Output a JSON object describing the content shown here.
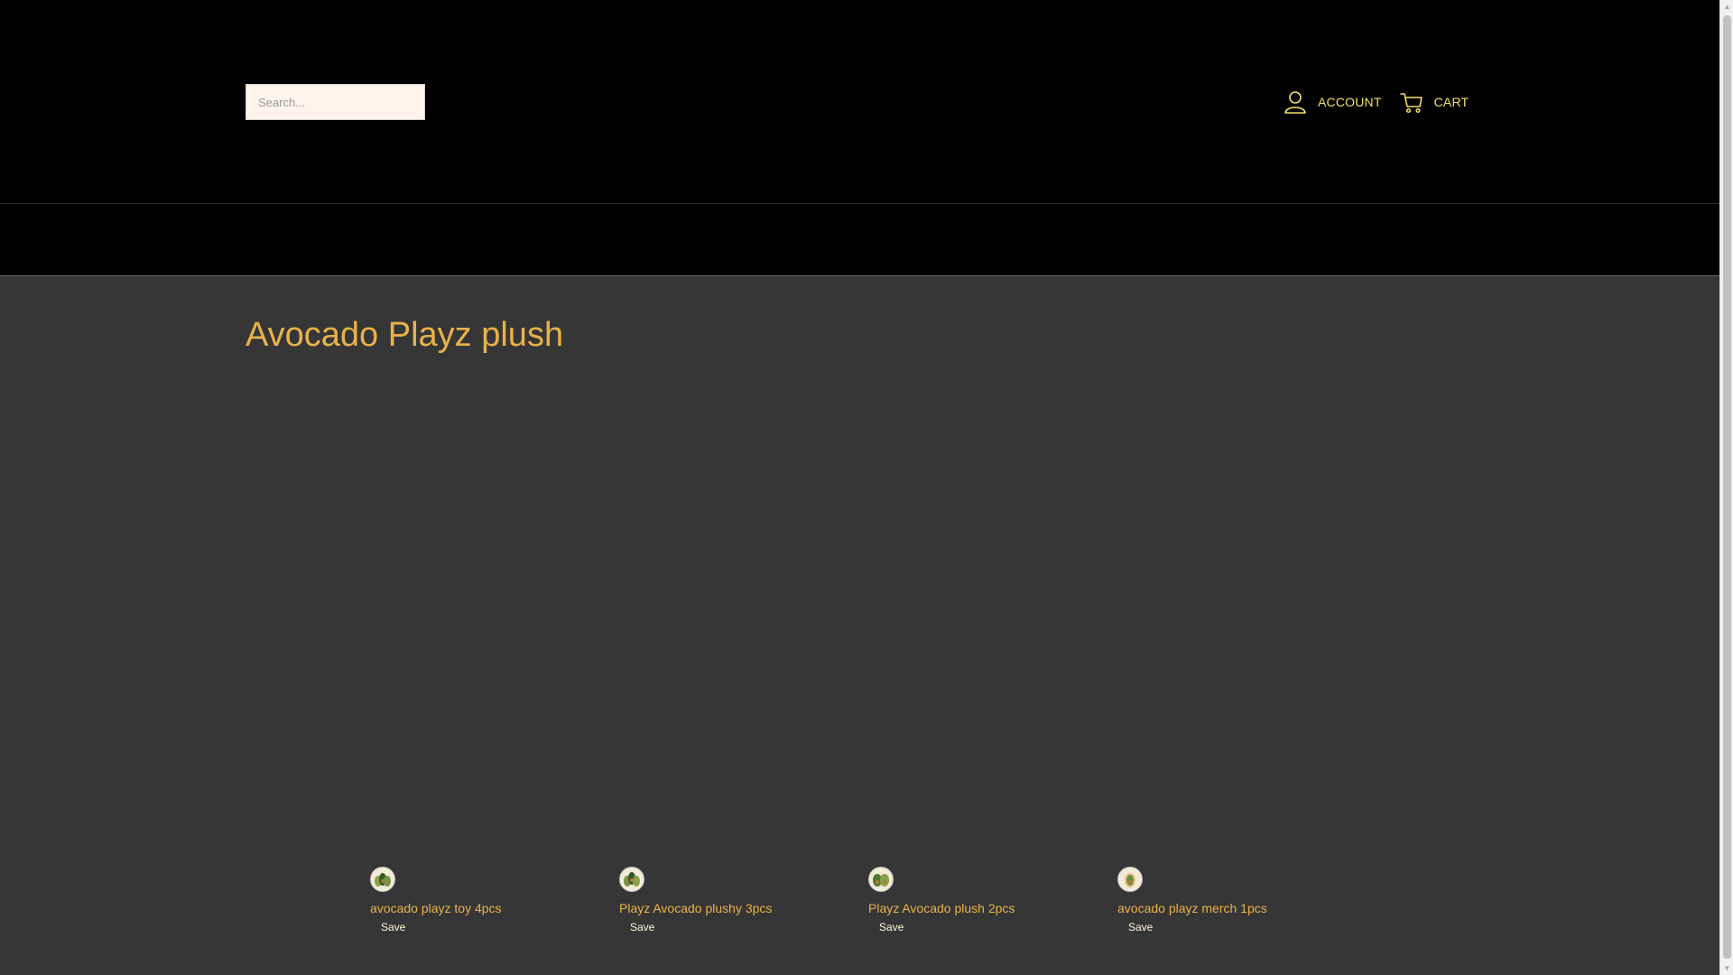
{
  "header": {
    "search_placeholder": "Search...",
    "account_label": "ACCOUNT",
    "cart_label": "CART",
    "account_icon": "user-icon",
    "cart_icon": "cart-icon",
    "link_color": "#f5e06b"
  },
  "collection": {
    "title": "Avocado Playz plush",
    "title_color": "#e8b24a"
  },
  "products": [
    {
      "title": "avocado playz toy 4pcs",
      "badge": "Save"
    },
    {
      "title": "Playz Avocado plushy 3pcs",
      "badge": "Save"
    },
    {
      "title": "Playz Avocado plush 2pcs",
      "badge": "Save"
    },
    {
      "title": "avocado playz merch 1pcs",
      "badge": "Save"
    }
  ]
}
